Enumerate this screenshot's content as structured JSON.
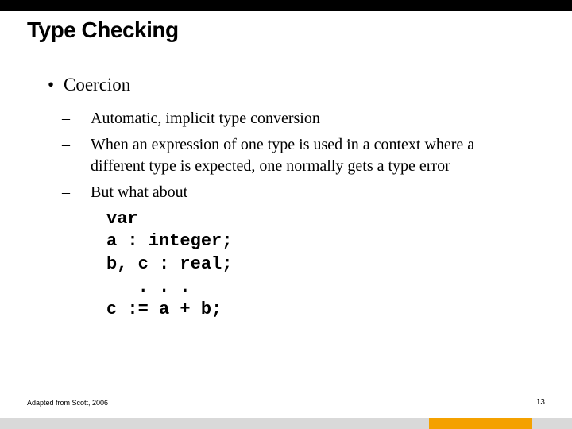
{
  "title": "Type Checking",
  "bullets": {
    "l1_0": "Coercion",
    "l2_0": "Automatic, implicit type conversion",
    "l2_1": "When an expression of one type is used in a context where a different type is expected, one normally gets a type error",
    "l2_2": "But what about"
  },
  "code": {
    "line0": "var",
    "line1": "a : integer;",
    "line2": "b, c : real;",
    "line3": "   . . .",
    "line4": "c := a + b;"
  },
  "footer": {
    "attribution": "Adapted from Scott, 2006",
    "page": "13"
  }
}
